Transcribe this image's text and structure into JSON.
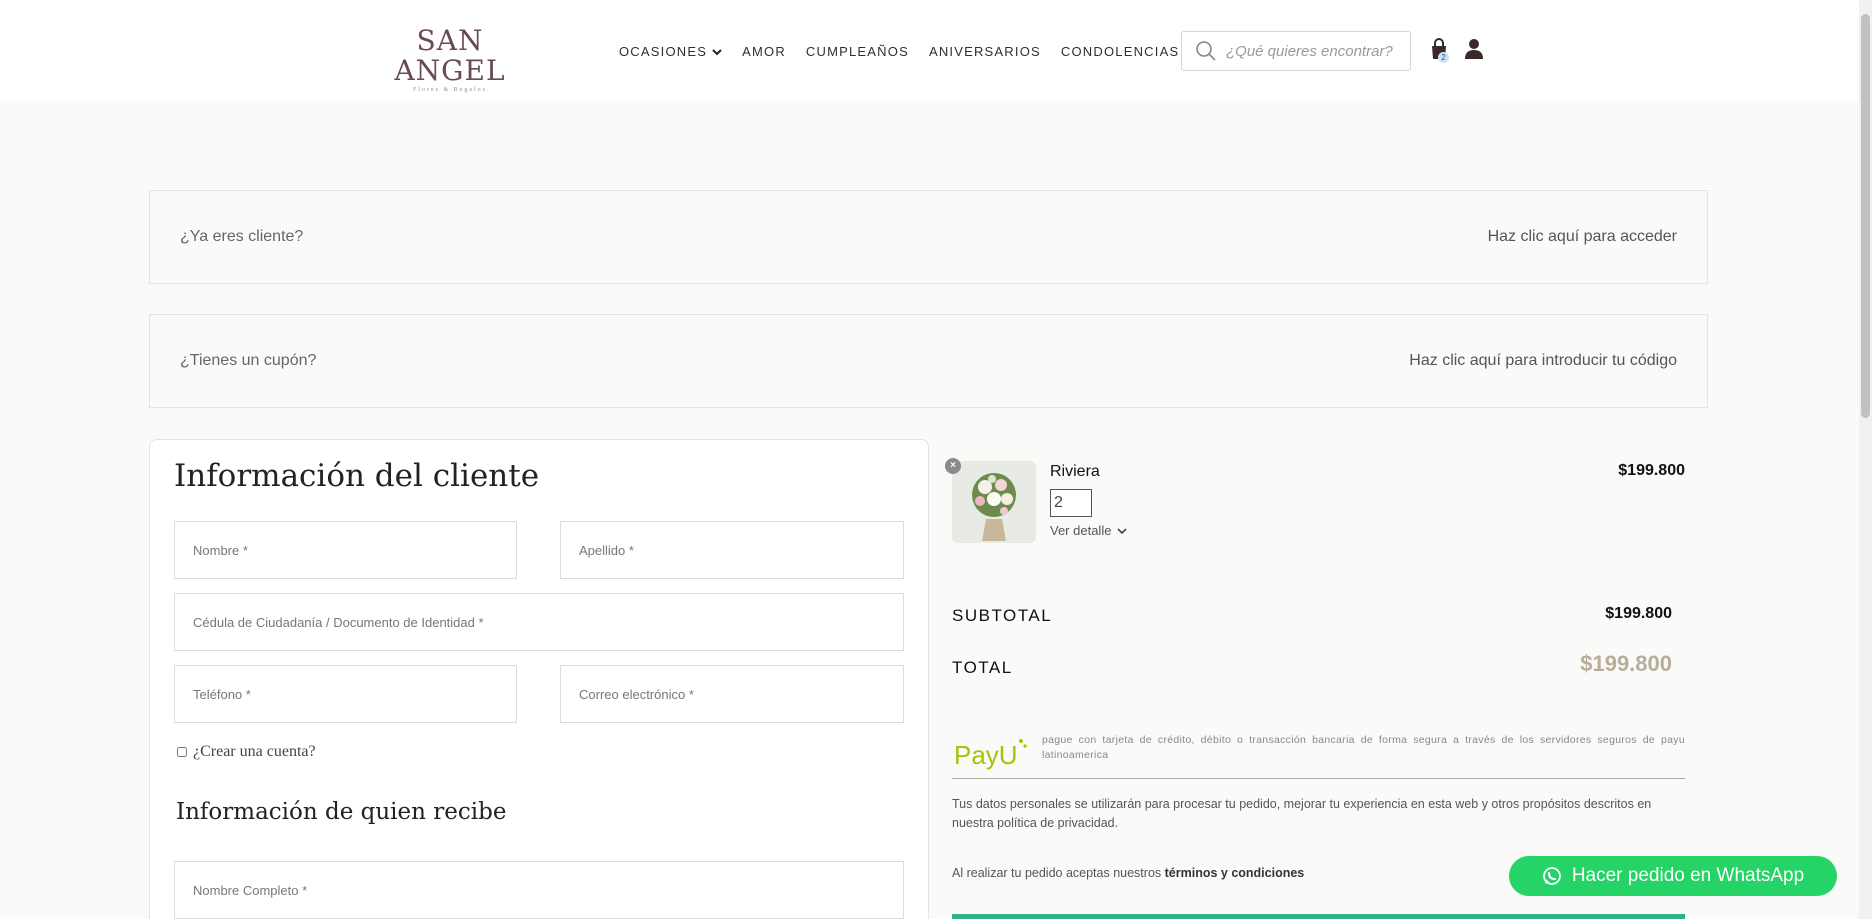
{
  "header": {
    "logo_main": "SAN ANGEL",
    "logo_sub": "Flores & Regalos",
    "nav": [
      {
        "label": "OCASIONES",
        "has_dropdown": true
      },
      {
        "label": "AMOR"
      },
      {
        "label": "CUMPLEAÑOS"
      },
      {
        "label": "ANIVERSARIOS"
      },
      {
        "label": "CONDOLENCIAS"
      }
    ],
    "search_placeholder": "¿Qué quieres encontrar?",
    "cart_count": "2",
    "icons": [
      "search-icon",
      "shopping-bag-icon",
      "user-icon",
      "chevron-down-icon"
    ]
  },
  "notices": {
    "login_text": "¿Ya eres cliente?",
    "login_link": "Haz clic aquí para acceder",
    "coupon_text": "¿Tienes un cupón?",
    "coupon_link": "Haz clic aquí para introducir tu código"
  },
  "customer_form": {
    "title": "Información del cliente",
    "first_name": "Nombre *",
    "last_name": "Apellido *",
    "id_document": "Cédula de Ciudadanía / Documento de Identidad *",
    "phone": "Teléfono *",
    "email": "Correo electrónico *",
    "create_account": "¿Crear una cuenta?",
    "recipient_title": "Información de quien recibe",
    "recipient_name": "Nombre Completo *"
  },
  "order": {
    "product_name": "Riviera",
    "product_price": "$199.800",
    "quantity": "2",
    "detail_link": "Ver detalle",
    "subtotal_label": "SUBTOTAL",
    "subtotal_value": "$199.800",
    "total_label": "TOTAL",
    "total_value": "$199.800",
    "payu_text": "pague con tarjeta de crédito, débito o transacción bancaria de forma segura a través de los servidores seguros de payu latinoamerica",
    "privacy_text": "Tus datos personales se utilizarán para procesar tu pedido, mejorar tu experiencia en esta web y otros propósitos descritos en nuestra política de privacidad.",
    "terms_prefix": "Al realizar tu pedido aceptas nuestros",
    "terms_link": "términos y condiciones"
  },
  "whatsapp_button": "Hacer pedido en WhatsApp",
  "colors": {
    "accent_green": "#25d366",
    "total_gold": "#b7ad99",
    "brand": "#6b4a4f",
    "checkout_bar": "#2fb383"
  }
}
